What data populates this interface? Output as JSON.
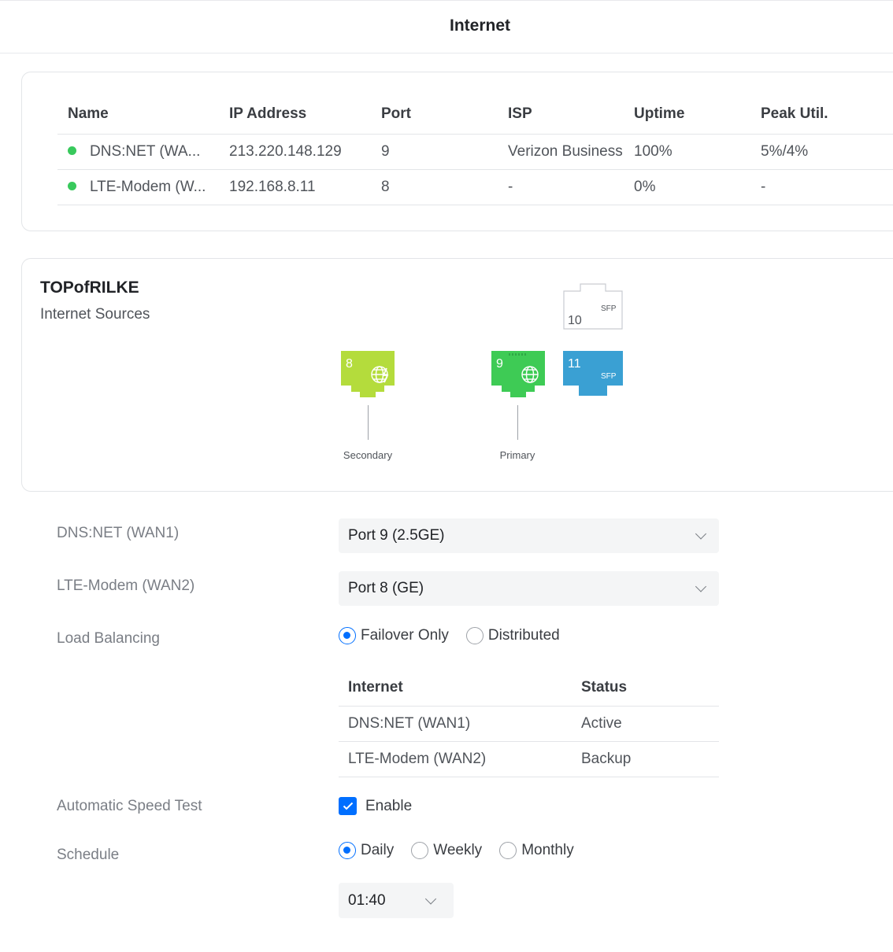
{
  "header": {
    "title": "Internet"
  },
  "wan_table": {
    "columns": [
      "Name",
      "IP Address",
      "Port",
      "ISP",
      "Uptime",
      "Peak Util."
    ],
    "rows": [
      {
        "name": "DNS:NET (WA...",
        "ip": "213.220.148.129",
        "port": "9",
        "isp": "Verizon Business",
        "uptime": "100%",
        "peak": "5%/4%",
        "status_color": "#38c95c"
      },
      {
        "name": "LTE-Modem (W...",
        "ip": "192.168.8.11",
        "port": "8",
        "isp": "-",
        "uptime": "0%",
        "peak": "-",
        "status_color": "#38c95c"
      }
    ]
  },
  "diagram": {
    "device_name": "TOPofRILKE",
    "subtitle": "Internet Sources",
    "ports": [
      {
        "number": "10",
        "type": "SFP",
        "state": "empty"
      },
      {
        "number": "8",
        "icon": "globe-icon",
        "state": "secondary",
        "color": "#b4dc3c",
        "label": "Secondary"
      },
      {
        "number": "9",
        "icon": "globe-icon",
        "state": "primary",
        "color": "#3ecb55",
        "label": "Primary"
      },
      {
        "number": "11",
        "type": "SFP",
        "state": "connected",
        "color": "#3aa0d3"
      }
    ]
  },
  "settings": {
    "wan1": {
      "label": "DNS:NET (WAN1)",
      "value": "Port 9 (2.5GE)"
    },
    "wan2": {
      "label": "LTE-Modem (WAN2)",
      "value": "Port 8 (GE)"
    },
    "load_balancing": {
      "label": "Load Balancing",
      "options": [
        "Failover Only",
        "Distributed"
      ],
      "selected": "Failover Only"
    },
    "status_table": {
      "columns": [
        "Internet",
        "Status"
      ],
      "rows": [
        {
          "internet": "DNS:NET (WAN1)",
          "status": "Active"
        },
        {
          "internet": "LTE-Modem (WAN2)",
          "status": "Backup"
        }
      ]
    },
    "speed_test": {
      "label": "Automatic Speed Test",
      "checkbox_label": "Enable",
      "checked": true
    },
    "schedule": {
      "label": "Schedule",
      "options": [
        "Daily",
        "Weekly",
        "Monthly"
      ],
      "selected": "Daily",
      "time": "01:40"
    }
  },
  "colors": {
    "accent": "#006fff",
    "online": "#38c95c"
  }
}
